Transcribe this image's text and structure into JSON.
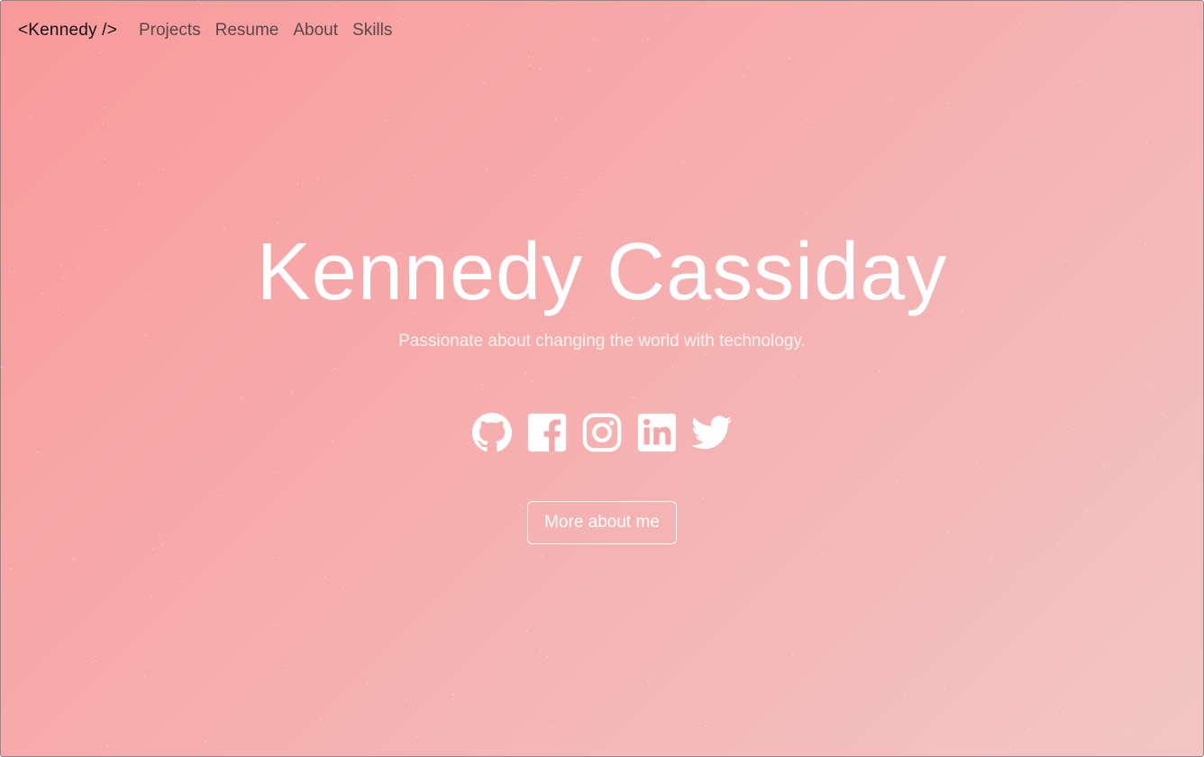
{
  "nav": {
    "brand": "<Kennedy />",
    "links": [
      "Projects",
      "Resume",
      "About",
      "Skills"
    ]
  },
  "hero": {
    "name": "Kennedy Cassiday",
    "tagline": "Passionate about changing the world with technology.",
    "cta_label": "More about me"
  },
  "socials": [
    {
      "icon": "github-icon"
    },
    {
      "icon": "facebook-icon"
    },
    {
      "icon": "instagram-icon"
    },
    {
      "icon": "linkedin-icon"
    },
    {
      "icon": "twitter-icon"
    }
  ],
  "colors": {
    "gradient_start": "#f99a9c",
    "gradient_end": "#f3c6c6",
    "text_primary": "#ffffff",
    "nav_text": "#5a4747",
    "brand_text": "#111111"
  }
}
